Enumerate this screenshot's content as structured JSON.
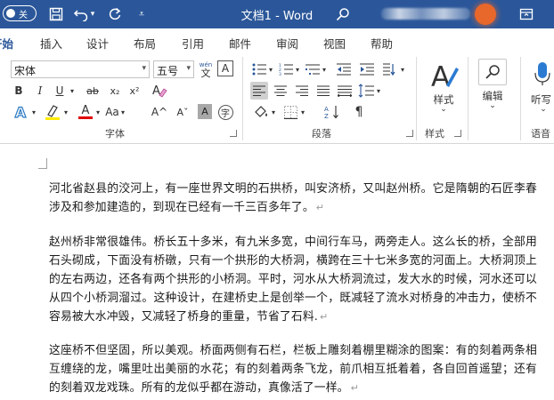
{
  "titlebar": {
    "autosave_label": "关",
    "doc_title": "文档1 - Word"
  },
  "tabs": [
    {
      "label": "开始",
      "active": true
    },
    {
      "label": "插入"
    },
    {
      "label": "设计"
    },
    {
      "label": "布局"
    },
    {
      "label": "引用"
    },
    {
      "label": "邮件"
    },
    {
      "label": "审阅"
    },
    {
      "label": "视图"
    },
    {
      "label": "帮助"
    }
  ],
  "ribbon": {
    "font": {
      "name": "宋体",
      "size": "五号",
      "phonetic_top": "wén",
      "phonetic_bottom": "文",
      "border_char": "A",
      "bold": "B",
      "italic": "I",
      "underline": "U",
      "strike": "ab",
      "subscript": "x₂",
      "superscript": "x²",
      "grow": "A^",
      "shrink": "Aˇ",
      "case": "Aa",
      "shade": "A",
      "circle": "字",
      "group_label": "字体",
      "highlight_color": "#ffeb00",
      "font_color": "#e00000"
    },
    "paragraph": {
      "group_label": "段落"
    },
    "styles": {
      "button_label": "样式",
      "group_label": "样式"
    },
    "editing": {
      "button_label": "编辑"
    },
    "voice": {
      "button_label": "听写",
      "group_label": "语音"
    }
  },
  "document": {
    "paragraphs": [
      {
        "text": "河北省赵县的洨河上，有一座世界文明的石拱桥，叫安济桥，又叫赵州桥。它是隋朝的石匠李春涉及和参加建造的，到现在已经有一千三百多年了。"
      },
      {
        "text": "赵州桥非常很雄伟。桥长五十多米，有九米多宽，中间行车马，两旁走人。这么长的桥，全部用石头砌成，下面没有桥礅，只有一个拱形的大桥洞，横跨在三十七米多宽的河面上。大桥洞顶上的左右两边，还各有两个拱形的小桥洞。平时，河水从大桥洞流过，发大水的时候，河水还可以从四个小桥洞溜过。这种设计，在建桥史上是创举一个，既减轻了流水对桥身的冲击力，使桥不容易被大水冲毁，又减轻了桥身的重量，节省了石料."
      },
      {
        "text": "这座桥不但坚固，所以美观。桥面两侧有石栏，栏板上雕刻着棚里糊涂的图案：有的刻着两条相互缠绕的龙，嘴里吐出美丽的水花；有的刻着两条飞龙，前爪相互抵着着，各自回首遥望；还有的刻着双龙戏珠。所有的龙似乎都在游动，真像活了一样。"
      }
    ],
    "paragraph_mark": "↵"
  },
  "colors": {
    "title_bar": "#2b579a",
    "accent": "#2b579a",
    "avatar": "#e8672b"
  }
}
